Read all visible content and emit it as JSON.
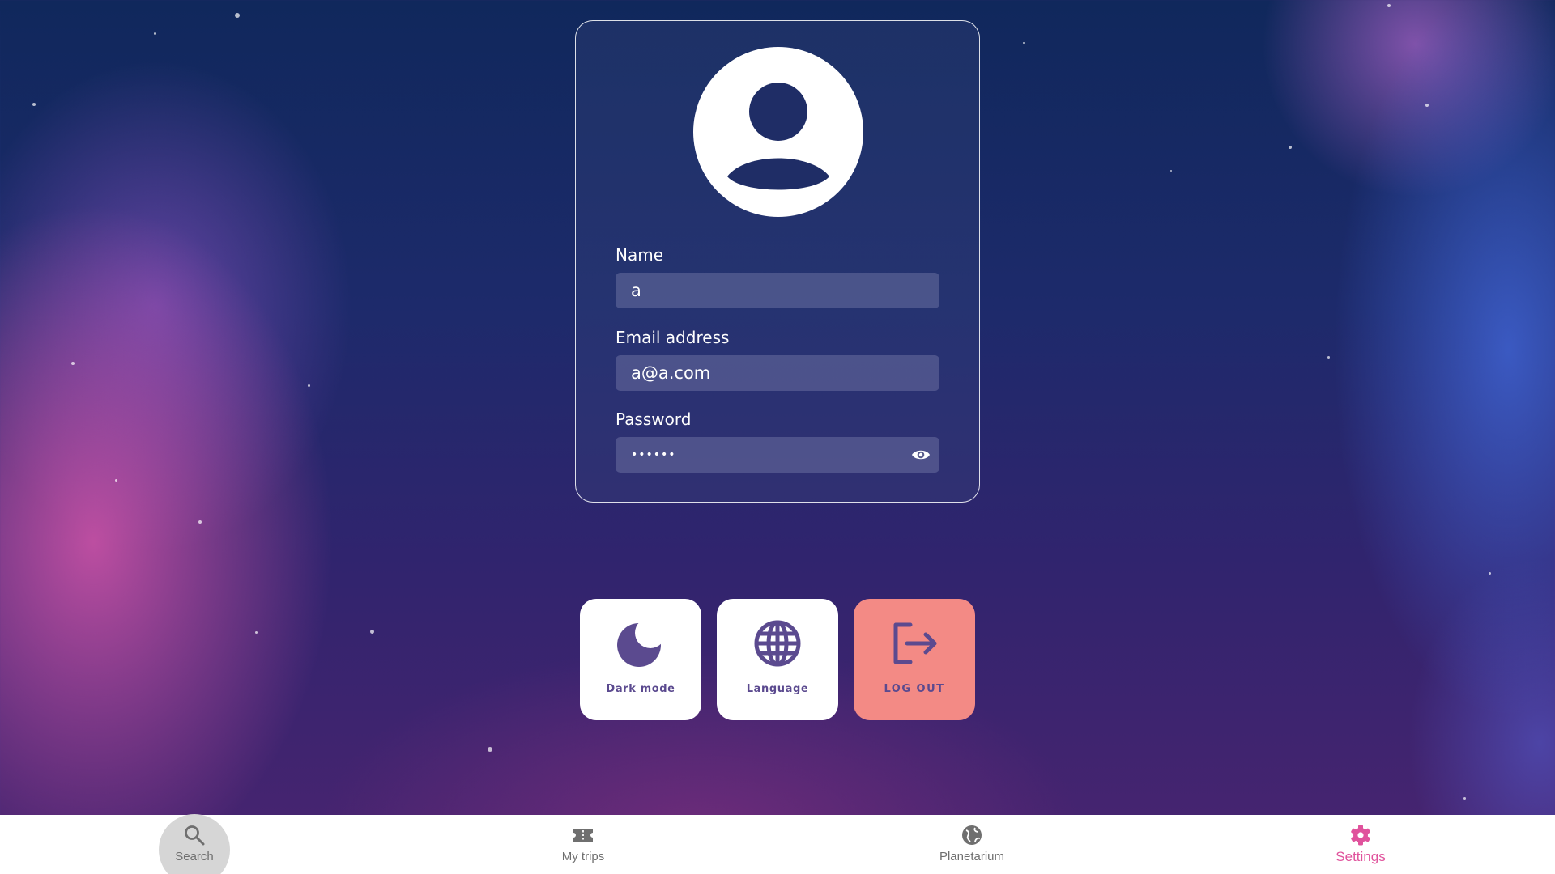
{
  "profile": {
    "avatar_icon": "account-circle-icon",
    "name": {
      "label": "Name",
      "value": "a"
    },
    "email": {
      "label": "Email address",
      "value": "a@a.com"
    },
    "password": {
      "label": "Password",
      "value": "••••••",
      "toggle_icon": "eye-icon"
    }
  },
  "actions": [
    {
      "label": "Dark mode",
      "icon": "moon-icon"
    },
    {
      "label": "Language",
      "icon": "globe-icon"
    },
    {
      "label": "LOG OUT",
      "icon": "logout-icon"
    }
  ],
  "nav": {
    "items": [
      {
        "label": "Search",
        "icon": "search-icon"
      },
      {
        "label": "My trips",
        "icon": "ticket-icon"
      },
      {
        "label": "Planetarium",
        "icon": "planet-icon"
      },
      {
        "label": "Settings",
        "icon": "gear-icon"
      }
    ],
    "active": "Settings"
  },
  "colors": {
    "accent": "#e0529c",
    "icon_purple": "#5b4a8f",
    "logout_bg": "#f38a85",
    "nav_icon": "#6f6f6f"
  }
}
